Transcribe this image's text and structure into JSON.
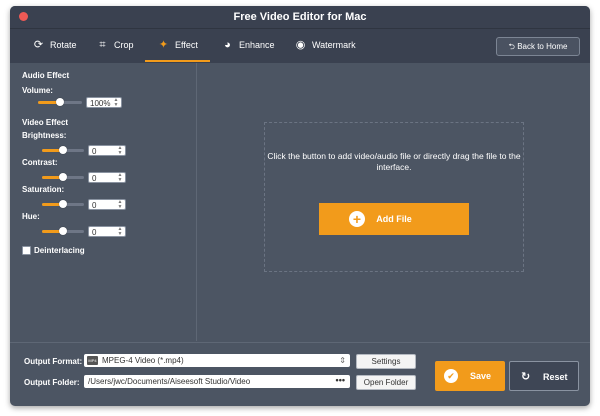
{
  "window": {
    "title": "Free Video Editor for Mac"
  },
  "toolbar": {
    "tabs": [
      {
        "label": "Rotate",
        "icon": "rotate-icon",
        "active": false
      },
      {
        "label": "Crop",
        "icon": "crop-icon",
        "active": false
      },
      {
        "label": "Effect",
        "icon": "effect-icon",
        "active": true
      },
      {
        "label": "Enhance",
        "icon": "palette-icon",
        "active": false
      },
      {
        "label": "Watermark",
        "icon": "watermark-icon",
        "active": false
      }
    ],
    "back_home_label": "Back to Home"
  },
  "sidebar": {
    "audio_effect_heading": "Audio Effect",
    "volume": {
      "label": "Volume:",
      "value": "100%",
      "level": 0.5
    },
    "video_effect_heading": "Video Effect",
    "brightness": {
      "label": "Brightness:",
      "value": "0",
      "level": 0.5
    },
    "contrast": {
      "label": "Contrast:",
      "value": "0",
      "level": 0.5
    },
    "saturation": {
      "label": "Saturation:",
      "value": "0",
      "level": 0.5
    },
    "hue": {
      "label": "Hue:",
      "value": "0",
      "level": 0.5
    },
    "deinterlacing": {
      "label": "Deinterlacing",
      "checked": false
    }
  },
  "main": {
    "drop_message": "Click the button to add video/audio file or directly drag the file to the interface.",
    "add_file_label": "Add File"
  },
  "bottom": {
    "output_format_label": "Output Format:",
    "output_format_value": "MPEG-4 Video (*.mp4)",
    "format_badge": "MP4",
    "settings_label": "Settings",
    "output_folder_label": "Output Folder:",
    "output_folder_value": "/Users/jwc/Documents/Aiseesoft Studio/Video",
    "browse_label": "•••",
    "open_folder_label": "Open Folder",
    "save_label": "Save",
    "reset_label": "Reset"
  },
  "colors": {
    "accent": "#f29b1b",
    "background": "#4c5563",
    "toolbar": "#3a4150"
  }
}
